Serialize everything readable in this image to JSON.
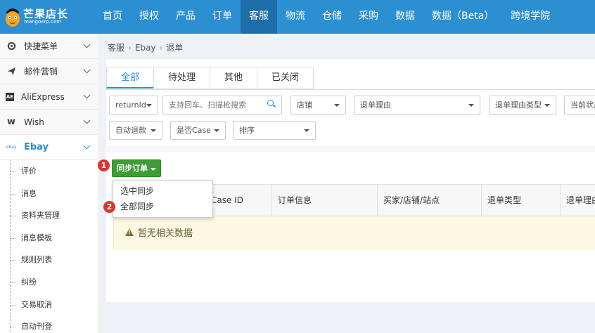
{
  "header": {
    "brand_title": "芒果店长",
    "brand_subtitle": "mangoerp.com",
    "nav": [
      {
        "label": "首页"
      },
      {
        "label": "授权"
      },
      {
        "label": "产品"
      },
      {
        "label": "订单"
      },
      {
        "label": "客服",
        "active": true
      },
      {
        "label": "物流"
      },
      {
        "label": "仓储"
      },
      {
        "label": "采购"
      },
      {
        "label": "数据"
      },
      {
        "label": "数据（Beta）"
      },
      {
        "label": "跨境学院"
      }
    ],
    "colors": {
      "bar": "#2b8fd1",
      "active": "#1e6ea7"
    }
  },
  "sidebar": {
    "items": [
      {
        "label": "快捷菜单",
        "icon": "gear-icon"
      },
      {
        "label": "邮件营销",
        "icon": "paper-plane-icon"
      },
      {
        "label": "AliExpress",
        "icon": "aliexpress-icon"
      },
      {
        "label": "Wish",
        "icon": "wish-icon"
      },
      {
        "label": "Ebay",
        "icon": "ebay-icon",
        "active": true
      }
    ],
    "icon_text": {
      "aliexpress": "AE",
      "wish": "w",
      "ebay": "ebay"
    },
    "sub_items": [
      "评价",
      "消息",
      "资料夹管理",
      "消息模板",
      "规则列表",
      "纠纷",
      "交易取消",
      "自动刊登"
    ]
  },
  "breadcrumb": [
    "客服",
    "Ebay",
    "退单"
  ],
  "tabs": [
    "全部",
    "待处理",
    "其他",
    "已关闭"
  ],
  "filters": {
    "return_id": "returnId",
    "search_placeholder": "支持回车、扫描枪搜索",
    "shop": "店铺",
    "return_reason": "退单理由",
    "return_reason_type": "退单理由类型",
    "current_status": "当前状态",
    "auto_refund": "自动退款",
    "is_case": "是否Case",
    "sort": "排序"
  },
  "sync_button": {
    "label": "同步订单",
    "color": "#3e9d34"
  },
  "dropdown": {
    "items": [
      "选中同步",
      "全部同步"
    ]
  },
  "badges": [
    "1",
    "2"
  ],
  "table": {
    "headers": [
      "Case ID",
      "订单信息",
      "买家/店铺/站点",
      "退单类型",
      "退单理由"
    ],
    "empty_message": "暂无相关数据"
  }
}
